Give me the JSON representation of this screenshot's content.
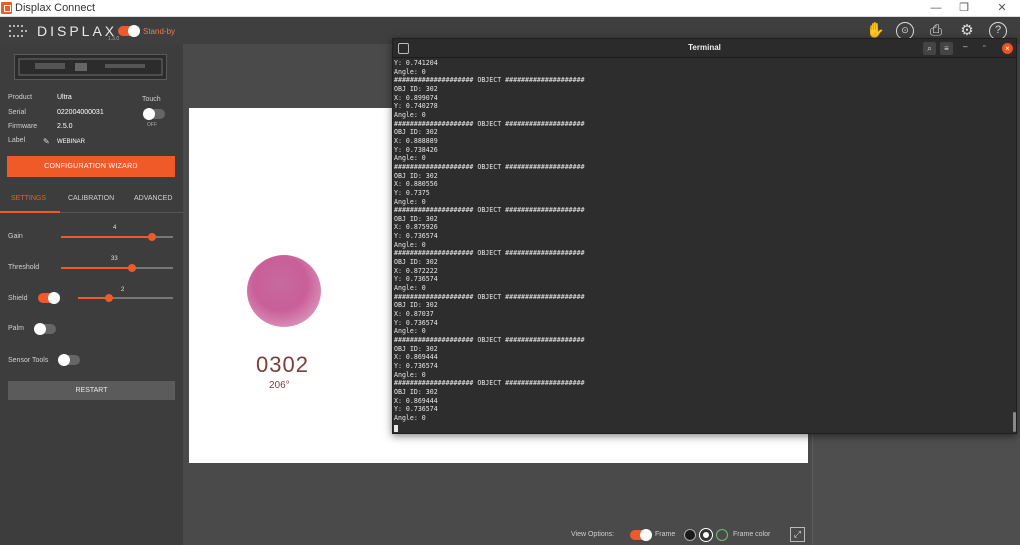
{
  "window": {
    "title": "Displax Connect",
    "controls": [
      "—",
      "❐",
      "✕"
    ]
  },
  "header": {
    "logo_text": "DISPLAX",
    "logo_version": "1.3.0",
    "standby_label": "Stand-by",
    "icons": [
      "touch-icon",
      "object-icon",
      "display-icon",
      "gear-icon",
      "help-icon"
    ],
    "icon_glyphs": [
      "✋",
      "⊙",
      "⎙",
      "⚙",
      "?"
    ],
    "accent": "#f05a28"
  },
  "sidebar": {
    "product_label": "Product",
    "product_value": "Ultra",
    "serial_label": "Serial",
    "serial_value": "022004000031",
    "firmware_label": "Firmware",
    "firmware_value": "2.5.0",
    "label_label": "Label",
    "label_value": "WEBINAR",
    "touch_label": "Touch",
    "touch_state": "OFF",
    "config_button": "CONFIGURATION WIZARD",
    "tabs": [
      "SETTINGS",
      "CALIBRATION",
      "ADVANCED"
    ],
    "active_tab": "SETTINGS",
    "gain": {
      "label": "Gain",
      "value": "4"
    },
    "threshold": {
      "label": "Threshold",
      "value": "33"
    },
    "shield": {
      "label": "Shield",
      "value": "2"
    },
    "palm_label": "Palm",
    "sensor_tools_label": "Sensor Tools",
    "restart_button": "RESTART"
  },
  "canvas": {
    "object_id": "0302",
    "object_angle": "206°"
  },
  "bottom": {
    "view_options": "View Options:",
    "frame": "Frame",
    "frame_color": "Frame color"
  },
  "terminal": {
    "title": "Terminal",
    "lines": [
      "Y: 0.741204",
      "Angle: 0",
      "#################### OBJECT ####################",
      "OBJ ID: 302",
      "X: 0.899074",
      "Y: 0.740278",
      "Angle: 0",
      "#################### OBJECT ####################",
      "OBJ ID: 302",
      "X: 0.888889",
      "Y: 0.738426",
      "Angle: 0",
      "#################### OBJECT ####################",
      "OBJ ID: 302",
      "X: 0.880556",
      "Y: 0.7375",
      "Angle: 0",
      "#################### OBJECT ####################",
      "OBJ ID: 302",
      "X: 0.875926",
      "Y: 0.736574",
      "Angle: 0",
      "#################### OBJECT ####################",
      "OBJ ID: 302",
      "X: 0.872222",
      "Y: 0.736574",
      "Angle: 0",
      "#################### OBJECT ####################",
      "OBJ ID: 302",
      "X: 0.87037",
      "Y: 0.736574",
      "Angle: 0",
      "#################### OBJECT ####################",
      "OBJ ID: 302",
      "X: 0.869444",
      "Y: 0.736574",
      "Angle: 0",
      "#################### OBJECT ####################",
      "OBJ ID: 302",
      "X: 0.869444",
      "Y: 0.736574",
      "Angle: 0"
    ]
  }
}
